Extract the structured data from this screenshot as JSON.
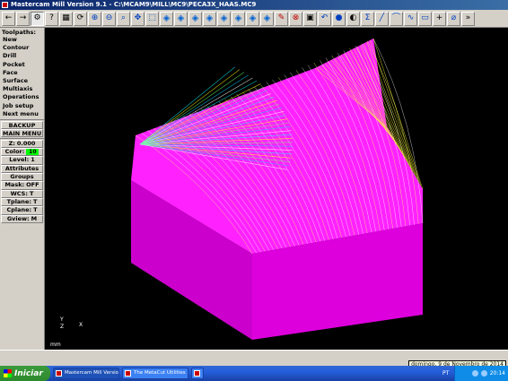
{
  "window": {
    "title": "Mastercam Mill Version 9.1 - C:\\MCAM9\\MILL\\MC9\\PECA3X_HAAS.MC9"
  },
  "toolbar": {
    "buttons": [
      {
        "icon": "arrow-left-icon",
        "glyph": "←"
      },
      {
        "icon": "arrow-right-icon",
        "glyph": "→"
      },
      {
        "icon": "toolbar-config-icon",
        "glyph": "⚙"
      },
      {
        "icon": "help-icon",
        "glyph": "?"
      },
      {
        "icon": "calculator-icon",
        "glyph": "▦"
      },
      {
        "icon": "repaint-icon",
        "glyph": "⟳"
      },
      {
        "icon": "zoom-in-icon",
        "glyph": "⊕"
      },
      {
        "icon": "zoom-out-icon",
        "glyph": "⊖"
      },
      {
        "icon": "zoom-fit-icon",
        "glyph": "⌕"
      },
      {
        "icon": "pan-icon",
        "glyph": "✥"
      },
      {
        "icon": "zoom-window-icon",
        "glyph": "⬚"
      },
      {
        "icon": "view-front-cube-icon",
        "glyph": "◈"
      },
      {
        "icon": "view-top-cube-icon",
        "glyph": "◈"
      },
      {
        "icon": "view-side-cube-icon",
        "glyph": "◈"
      },
      {
        "icon": "view-iso-cube-icon",
        "glyph": "◈"
      },
      {
        "icon": "view-cube-5-icon",
        "glyph": "◈"
      },
      {
        "icon": "view-cube-6-icon",
        "glyph": "◈"
      },
      {
        "icon": "view-cube-7-icon",
        "glyph": "◈"
      },
      {
        "icon": "view-cube-8-icon",
        "glyph": "◈"
      },
      {
        "icon": "measure-icon",
        "glyph": "✎"
      },
      {
        "icon": "delete-icon",
        "glyph": "⊗"
      },
      {
        "icon": "shade-icon",
        "glyph": "▣"
      },
      {
        "icon": "undo-icon",
        "glyph": "↶"
      },
      {
        "icon": "sphere-icon",
        "glyph": "●"
      },
      {
        "icon": "render-icon",
        "glyph": "◐"
      },
      {
        "icon": "sigma-icon",
        "glyph": "Σ"
      },
      {
        "icon": "line-icon",
        "glyph": "╱"
      },
      {
        "icon": "arc-icon",
        "glyph": "⌒"
      },
      {
        "icon": "spline-icon",
        "glyph": "∿"
      },
      {
        "icon": "rectangle-icon",
        "glyph": "▭"
      },
      {
        "icon": "point-icon",
        "glyph": "+"
      },
      {
        "icon": "fillet-icon",
        "glyph": "⌀"
      },
      {
        "icon": "more-icon",
        "glyph": "»"
      }
    ]
  },
  "menu": {
    "header": "Toolpaths:",
    "items": [
      {
        "label": "New"
      },
      {
        "label": "Contour"
      },
      {
        "label": "Drill"
      },
      {
        "label": "Pocket"
      },
      {
        "label": "Face"
      },
      {
        "label": "Surface"
      },
      {
        "label": "Multiaxis"
      },
      {
        "label": "Operations"
      },
      {
        "label": "Job setup"
      },
      {
        "label": "Next menu"
      }
    ],
    "backup": "BACKUP",
    "main_menu": "MAIN MENU",
    "status": {
      "z_label": "Z:",
      "z_value": "0.000",
      "color_label": "Color:",
      "color_value": "10",
      "color_hex": "#00ff00",
      "level_label": "Level:",
      "level_value": "1",
      "attributes": "Attributes",
      "groups": "Groups",
      "mask_label": "Mask:",
      "mask_value": "OFF",
      "wcs_label": "WCS:",
      "wcs_value": "T",
      "tplane_label": "Tplane:",
      "tplane_value": "T",
      "cplane_label": "Cplane:",
      "cplane_value": "T",
      "gview_label": "Gview:",
      "gview_value": "M"
    }
  },
  "viewport": {
    "axis_y": "Y",
    "axis_z": "Z",
    "axis_x": "X",
    "units_label": "mm"
  },
  "prompt": {
    "tooltip": "domingo, 9 de Novembro de 2014"
  },
  "taskbar": {
    "start": "Iniciar",
    "tasks": [
      {
        "label": "Mastercam Mill Versio..."
      },
      {
        "label": "The MetaCut Utilities ..."
      },
      {
        "label": ""
      }
    ],
    "lang": "PT",
    "clock": "20:14"
  }
}
